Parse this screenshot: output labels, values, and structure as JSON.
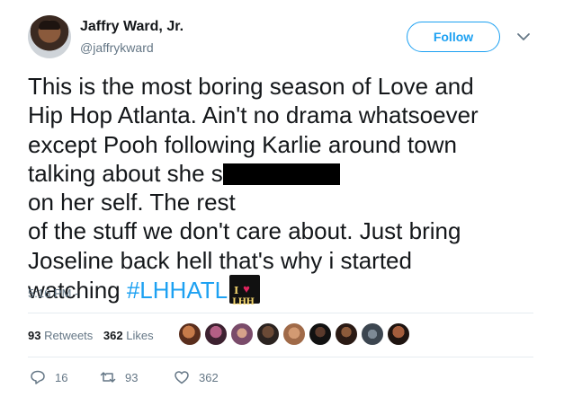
{
  "author": {
    "name": "Jaffry Ward, Jr.",
    "handle": "@jaffrykward"
  },
  "follow_label": "Follow",
  "tweet_lines": [
    "This is the most boring season of Love and",
    "Hip Hop Atlanta. Ain't no drama whatsoever",
    "except Pooh following Karlie around town",
    "talking about she s",
    " on her self. The rest",
    "of the stuff we don't care about. Just bring",
    "Joseline back hell that's why i started",
    "watching "
  ],
  "hashtag": "#LHHATL",
  "timestamp": "5:16 PM -",
  "stats": {
    "retweets_count": "93",
    "retweets_label": "Retweets",
    "likes_count": "362",
    "likes_label": "Likes"
  },
  "actions": {
    "reply_count": "16",
    "retweet_count": "93",
    "like_count": "362"
  },
  "icons": [
    "avatar",
    "chevron-down-icon",
    "lhh-emoji-icon",
    "reply-icon",
    "retweet-icon",
    "heart-icon"
  ],
  "colors": {
    "accent": "#1da1f2",
    "muted": "#657786",
    "text": "#14171a"
  }
}
